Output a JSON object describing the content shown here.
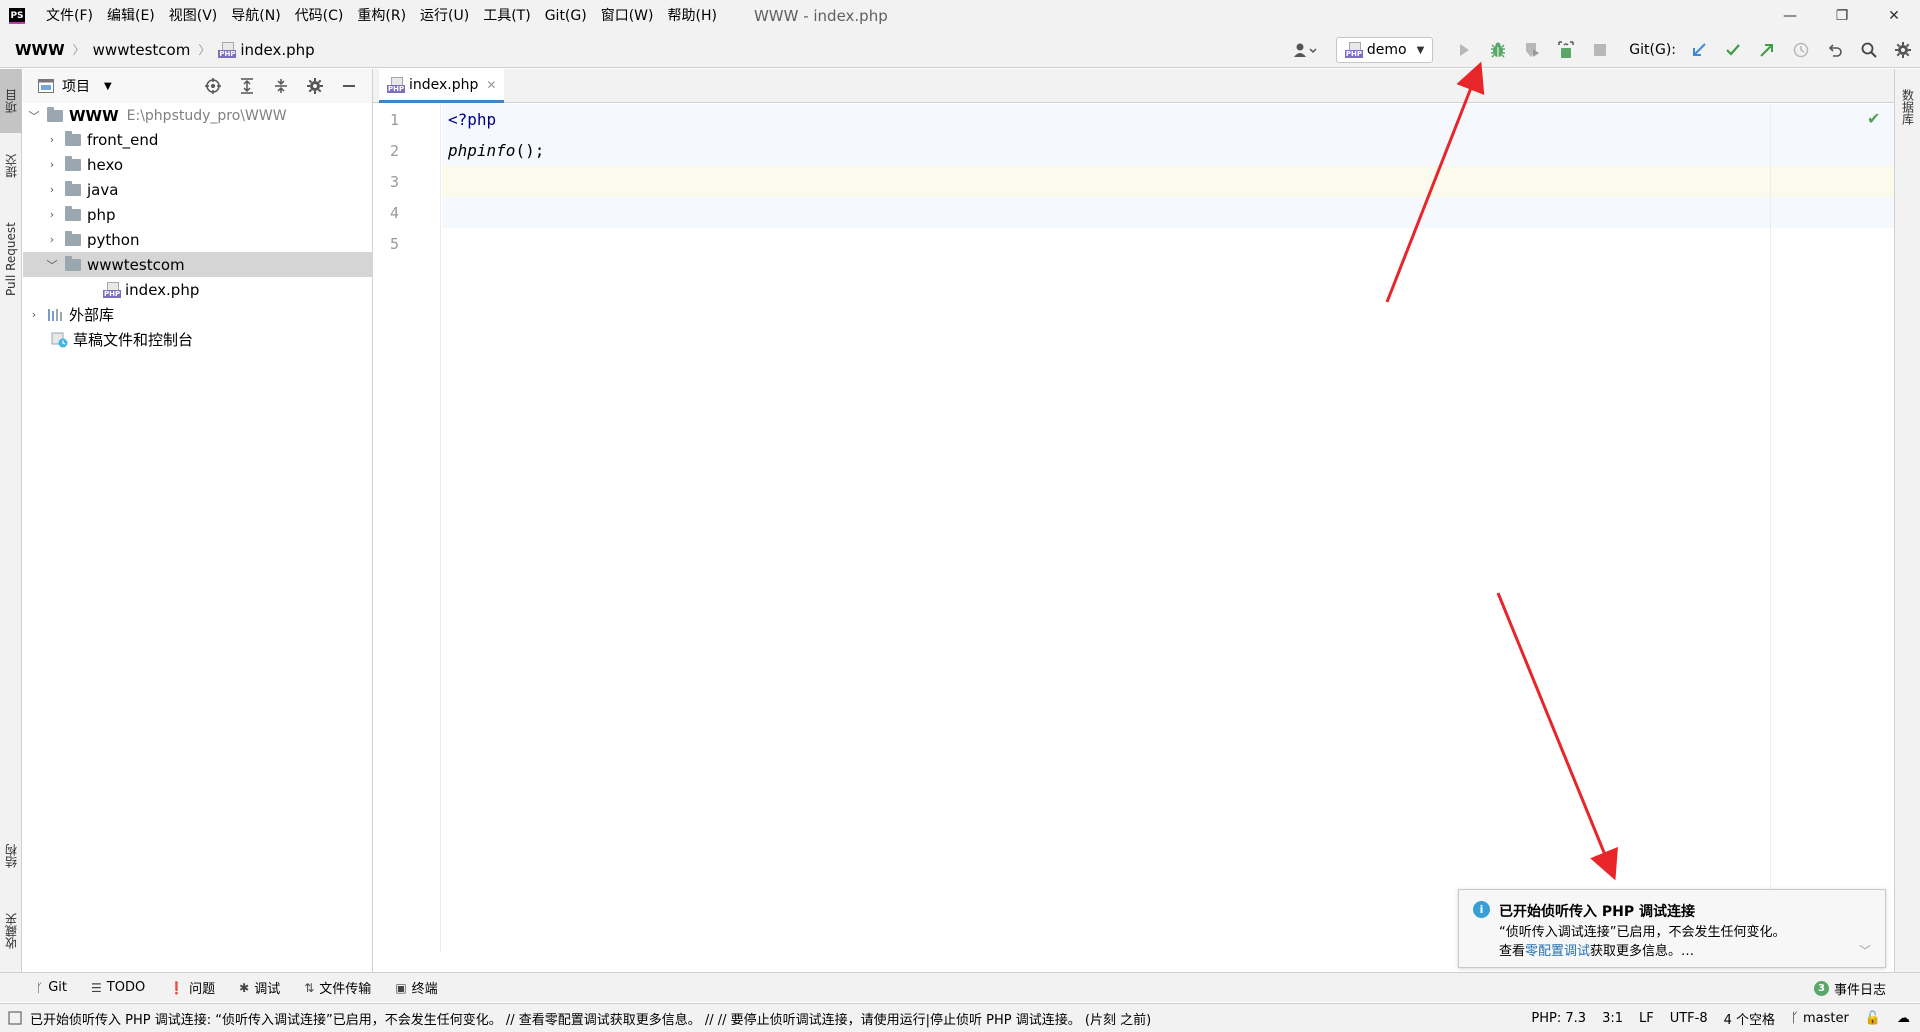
{
  "menubar": {
    "app_logo": "PS",
    "items": [
      "文件(F)",
      "编辑(E)",
      "视图(V)",
      "导航(N)",
      "代码(C)",
      "重构(R)",
      "运行(U)",
      "工具(T)",
      "Git(G)",
      "窗口(W)",
      "帮助(H)"
    ],
    "window_title": "WWW - index.php",
    "controls": {
      "minimize": "—",
      "restore": "❐",
      "close": "✕"
    }
  },
  "navbar": {
    "breadcrumb_root": "WWW",
    "breadcrumb_folder": "wwwtestcom",
    "breadcrumb_file": "index.php",
    "run_config": "demo",
    "git_label": "Git(G):"
  },
  "left_strip": {
    "tabs": [
      "项目",
      "提交",
      "Pull Request",
      "结构",
      "收藏夹"
    ]
  },
  "right_strip": {
    "tabs": [
      "数据库"
    ]
  },
  "project_panel": {
    "title": "项目",
    "root": {
      "name": "WWW",
      "path": "E:\\phpstudy_pro\\WWW"
    },
    "folders": [
      "front_end",
      "hexo",
      "java",
      "php",
      "python",
      "wwwtestcom"
    ],
    "open_file": "index.php",
    "external_libs": "外部库",
    "scratches": "草稿文件和控制台"
  },
  "editor": {
    "tab_label": "index.php",
    "line_numbers": [
      "1",
      "2",
      "3",
      "4",
      "5"
    ],
    "code": {
      "line1": "<?php",
      "line2_fn": "phpinfo",
      "line2_rest": "();"
    }
  },
  "notification": {
    "title": "已开始侦听传入 PHP 调试连接",
    "line1": "“侦听传入调试连接”已启用，不会发生任何变化。",
    "line2_prefix": "查看",
    "line2_link": "零配置调试",
    "line2_suffix": "获取更多信息。…"
  },
  "bottom_tools": {
    "git": "Git",
    "todo": "TODO",
    "problems": "问题",
    "debug": "调试",
    "file_transfer": "文件传输",
    "terminal": "终端",
    "event_log_count": "3",
    "event_log": "事件日志"
  },
  "statusbar": {
    "message": "已开始侦听传入 PHP 调试连接: “侦听传入调试连接”已启用，不会发生任何变化。 // 查看零配置调试获取更多信息。 // // 要停止侦听调试连接，请使用运行|停止侦听 PHP 调试连接。 (片刻 之前)",
    "php_version": "PHP: 7.3",
    "caret_pos": "3:1",
    "line_sep": "LF",
    "encoding": "UTF-8",
    "indent": "4 个空格",
    "branch": "master"
  },
  "colors": {
    "accent": "#4083c9",
    "debug_green": "#59a869",
    "annotation_red": "#e8262a",
    "line_highlight": "#fcfaed",
    "code_bg": "#f5f9fe"
  }
}
